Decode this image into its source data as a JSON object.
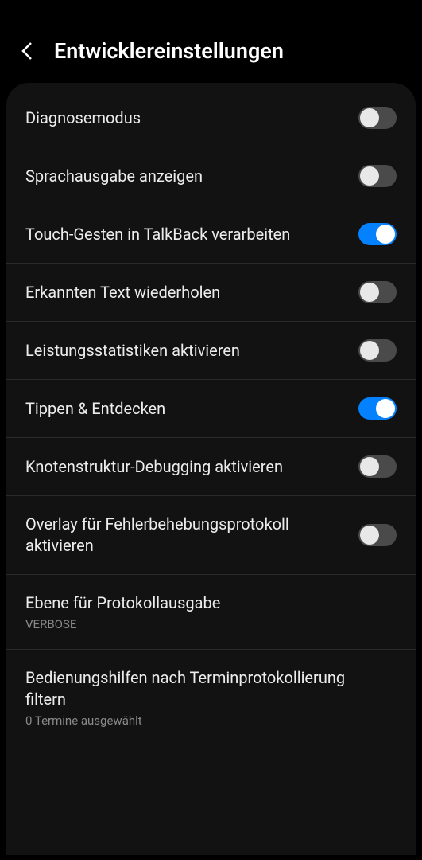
{
  "header": {
    "title": "Entwicklereinstellungen"
  },
  "items": [
    {
      "label": "Diagnosemodus",
      "type": "toggle",
      "on": false
    },
    {
      "label": "Sprachausgabe anzeigen",
      "type": "toggle",
      "on": false
    },
    {
      "label": "Touch-Gesten in TalkBack verarbeiten",
      "type": "toggle",
      "on": true
    },
    {
      "label": "Erkannten Text wiederholen",
      "type": "toggle",
      "on": false
    },
    {
      "label": "Leistungsstatistiken aktivieren",
      "type": "toggle",
      "on": false
    },
    {
      "label": "Tippen & Entdecken",
      "type": "toggle",
      "on": true
    },
    {
      "label": "Knotenstruktur-Debugging aktivieren",
      "type": "toggle",
      "on": false
    },
    {
      "label": "Overlay für Fehlerbehebungsprotokoll aktivieren",
      "type": "toggle",
      "on": false
    },
    {
      "label": "Ebene für Protokollausgabe",
      "type": "value",
      "sub": "VERBOSE"
    },
    {
      "label": "Bedienungshilfen nach Terminprotokollierung filtern",
      "type": "value",
      "sub": "0 Termine ausgewählt"
    }
  ]
}
